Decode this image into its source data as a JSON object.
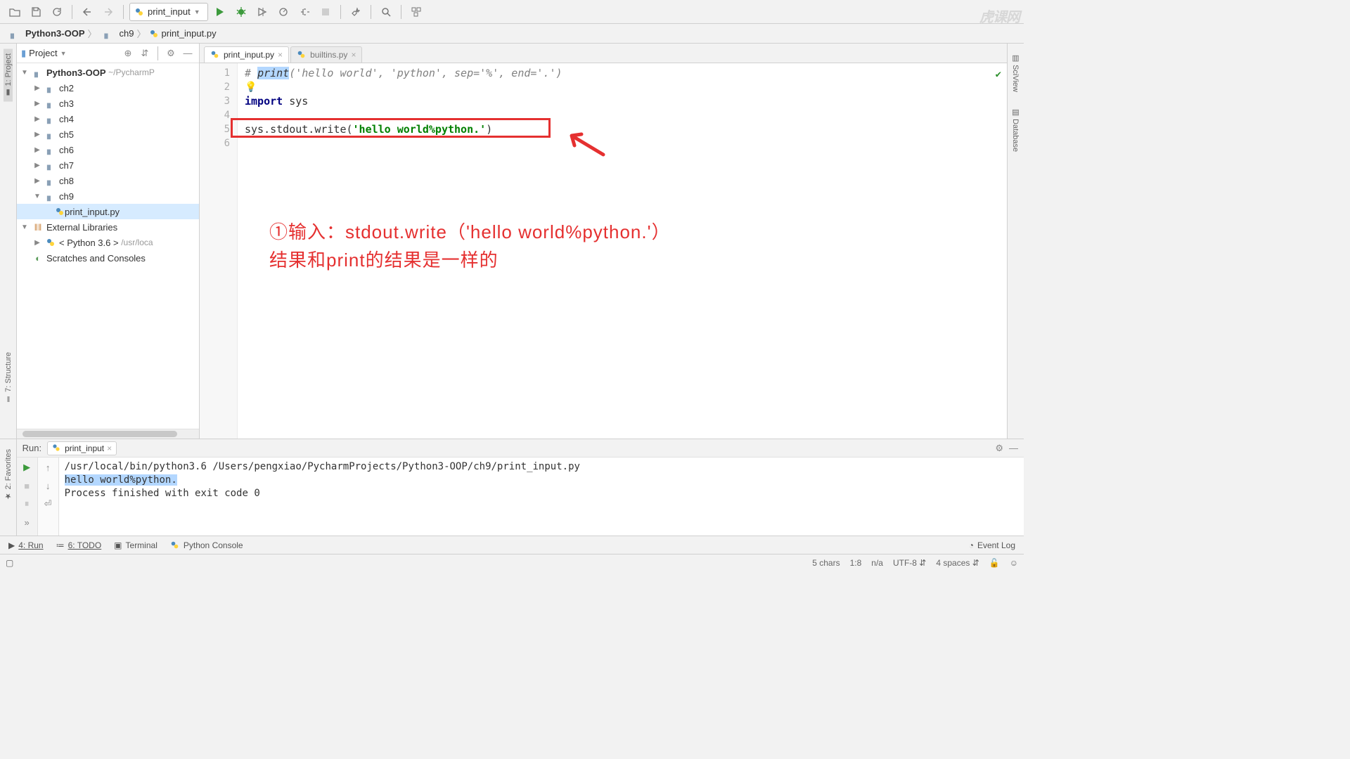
{
  "toolbar": {
    "run_config": "print_input"
  },
  "breadcrumb": {
    "root": "Python3-OOP",
    "folder": "ch9",
    "file": "print_input.py"
  },
  "left_tabs": {
    "project": "1: Project",
    "structure": "7: Structure",
    "favorites": "2: Favorites"
  },
  "right_tabs": {
    "sciview": "SciView",
    "database": "Database"
  },
  "project_panel": {
    "title": "Project",
    "root": "Python3-OOP",
    "root_path": "~/PycharmP",
    "folders": [
      "ch2",
      "ch3",
      "ch4",
      "ch5",
      "ch6",
      "ch7",
      "ch8",
      "ch9"
    ],
    "ch9_file": "print_input.py",
    "ext_lib": "External Libraries",
    "python_env": "< Python 3.6 >",
    "python_env_path": "/usr/loca",
    "scratches": "Scratches and Consoles"
  },
  "editor": {
    "tabs": [
      {
        "label": "print_input.py",
        "active": true
      },
      {
        "label": "builtins.py",
        "active": false
      }
    ],
    "lines": [
      "1",
      "2",
      "3",
      "4",
      "5",
      "6"
    ],
    "code": {
      "l1_hash": "# ",
      "l1_print": "print",
      "l1_rest": "('hello world', 'python', sep='%', end='.')",
      "l3_kw": "import",
      "l3_mod": " sys",
      "l5_a": "sys.stdout.write(",
      "l5_str": "'hello world%python.'",
      "l5_b": ")"
    }
  },
  "annotation": {
    "line1": "①输入：stdout.write（'hello world%python.'）",
    "line2": "结果和print的结果是一样的"
  },
  "run": {
    "label": "Run:",
    "tab": "print_input",
    "line1": "/usr/local/bin/python3.6 /Users/pengxiao/PycharmProjects/Python3-OOP/ch9/print_input.py",
    "line2": "hello world%python.",
    "line3": "Process finished with exit code 0"
  },
  "bottom": {
    "run": "4: Run",
    "todo": "6: TODO",
    "terminal": "Terminal",
    "pyconsole": "Python Console",
    "event_log": "Event Log"
  },
  "status": {
    "chars": "5 chars",
    "pos": "1:8",
    "na": "n/a",
    "enc": "UTF-8",
    "indent": "4 spaces"
  },
  "watermark": "虎课网"
}
